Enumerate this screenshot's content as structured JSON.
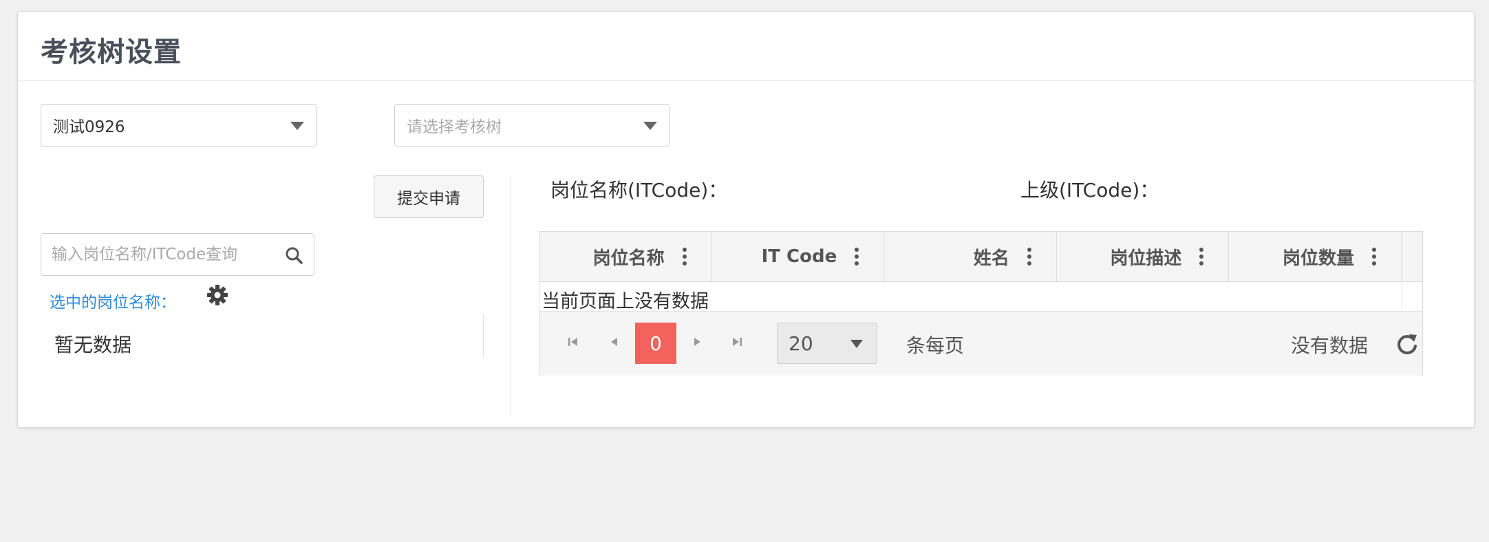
{
  "page": {
    "title": "考核树设置"
  },
  "filters": {
    "org_select": {
      "value": "测试0926"
    },
    "tree_select": {
      "placeholder": "请选择考核树"
    }
  },
  "left_panel": {
    "submit_label": "提交申请",
    "search_placeholder": "输入岗位名称/ITCode查询",
    "selected_label": "选中的岗位名称：",
    "empty_text": "暂无数据"
  },
  "right_panel": {
    "post_label": "岗位名称(ITCode)：",
    "parent_label": "上级(ITCode)："
  },
  "grid": {
    "columns": [
      "岗位名称",
      "IT Code",
      "姓名",
      "岗位描述",
      "岗位数量"
    ],
    "empty_message": "当前页面上没有数据"
  },
  "pager": {
    "current_page": "0",
    "page_size": "20",
    "per_page_label": "条每页",
    "status": "没有数据"
  }
}
